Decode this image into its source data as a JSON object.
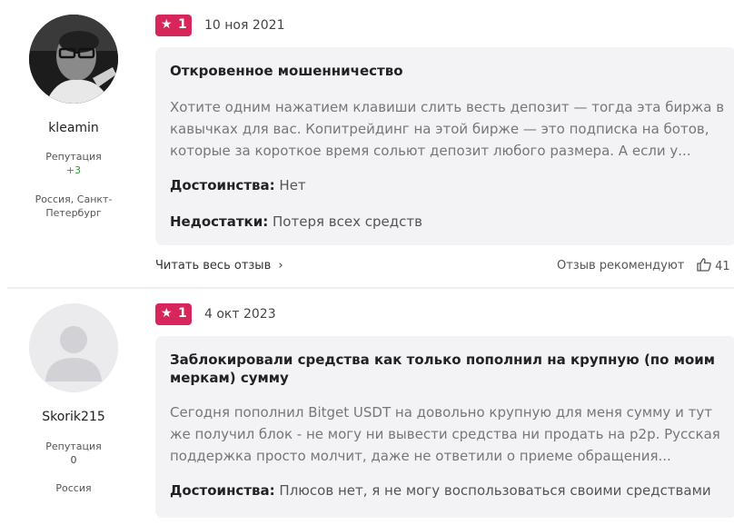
{
  "reviews": [
    {
      "badge": "1",
      "date": "10 ноя 2021",
      "user": {
        "name": "kleamin",
        "reputation_label": "Репутация",
        "reputation": "+3",
        "location": "Россия, Санкт-Петербург"
      },
      "title": "Откровенное мошенничество",
      "body": "Хотите одним нажатием клавиши слить весть депозит — тогда эта биржа в кавычках для вас. Копитрейдинг на этой бирже — это подписка на ботов, которые за короткое время сольют депозит любого размера. А если у...",
      "pros_label": "Достоинства:",
      "pros": "Нет",
      "cons_label": "Недостатки:",
      "cons": "Потеря всех средств",
      "read_more": "Читать весь отзыв",
      "recommend": "Отзыв рекомендуют",
      "likes": "41"
    },
    {
      "badge": "1",
      "date": "4 окт 2023",
      "user": {
        "name": "Skorik215",
        "reputation_label": "Репутация",
        "reputation": "0",
        "location": "Россия"
      },
      "title": "Заблокировали средства как только пополнил на крупную (по моим меркам) сумму",
      "body": "Сегодня пополнил Bitget USDT на довольно крупную для меня сумму и тут же получил блок - не могу ни вывести средства ни продать на p2p. Русская поддержка просто молчит, даже не ответили о приеме обращения...",
      "pros_label": "Достоинства:",
      "pros": "Плюсов нет, я не могу воспользоваться своими средствами"
    }
  ],
  "colors": {
    "badge": "#d7265a",
    "card_bg": "#f3f3f5",
    "positive": "#2e9b3c"
  },
  "icons": {
    "badge": "star-icon",
    "read_more": "chevron-right-icon",
    "like": "thumbs-up-icon"
  }
}
